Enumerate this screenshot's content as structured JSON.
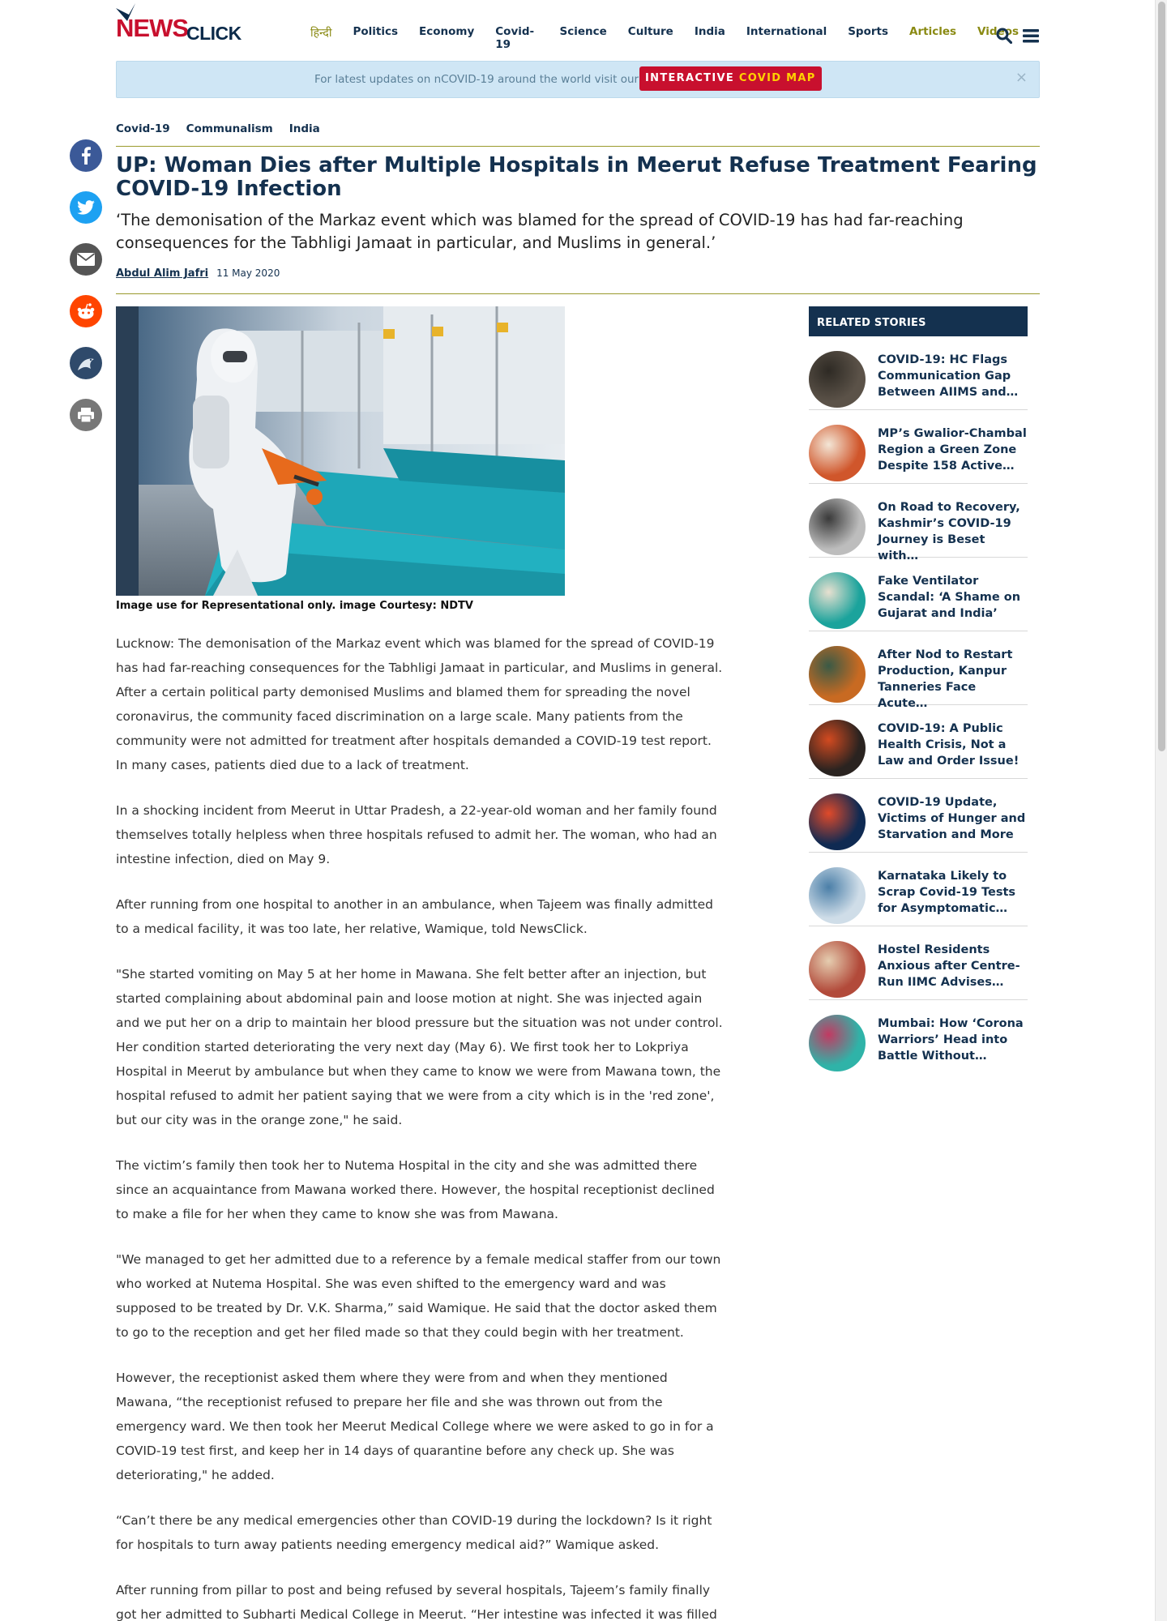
{
  "brand": {
    "logo_news": "NEWS",
    "logo_click": "CLICK"
  },
  "nav": {
    "items": [
      {
        "label": "हिन्दी",
        "style": "hindi"
      },
      {
        "label": "Politics"
      },
      {
        "label": "Economy"
      },
      {
        "label": "Covid-19"
      },
      {
        "label": "Science"
      },
      {
        "label": "Culture"
      },
      {
        "label": "India"
      },
      {
        "label": "International"
      },
      {
        "label": "Sports"
      },
      {
        "label": "Articles",
        "style": "olive"
      },
      {
        "label": "Videos",
        "style": "olive"
      }
    ],
    "search_icon": "search-icon",
    "menu_icon": "hamburger-menu-icon"
  },
  "banner": {
    "text": "For latest updates on nCOVID-19 around the world visit our",
    "cta_part1": "INTERACTIVE",
    "cta_part2": "COVID MAP",
    "close": "×"
  },
  "breadcrumb": [
    "Covid-19",
    "Communalism",
    "India"
  ],
  "article": {
    "title": "UP: Woman Dies after Multiple Hospitals in Meerut Refuse Treatment Fearing COVID-19 Infection",
    "subtitle": "‘The demonisation of the Markaz event which was blamed for the spread of COVID-19 has had far-reaching consequences for the Tabhligi Jamaat in particular, and Muslims in general.’",
    "author": "Abdul Alim Jafri",
    "date": "11 May 2020",
    "caption": "Image use for Representational only. image Courtesy: NDTV",
    "paragraphs": [
      "Lucknow: The demonisation of the Markaz event which was blamed for the spread of COVID-19 has had far-reaching consequences for the Tabhligi Jamaat in particular, and Muslims in general. After a certain political party demonised Muslims and blamed them for spreading the novel coronavirus, the community faced discrimination on a large scale. Many patients from the community were not admitted for treatment after hospitals demanded a COVID-19 test report. In many cases, patients died due to a lack of treatment.",
      "In a shocking incident from Meerut in Uttar Pradesh, a 22-year-old woman and her family found themselves totally helpless when three hospitals refused to admit her. The woman, who had an intestine infection, died on May 9.",
      "After running from one hospital to another in an ambulance, when Tajeem was finally admitted to a medical facility, it was too late, her relative, Wamique, told NewsClick.",
      "\"She started vomiting on May 5 at her home in Mawana. She felt better after an injection, but started complaining about abdominal pain and loose motion at night. She was injected again and we put her on a drip to maintain her blood pressure but the situation was not under control. Her condition started deteriorating the very next day (May 6). We first took her to Lokpriya Hospital in Meerut by ambulance but when they came to know we were from Mawana town, the hospital refused to admit her patient saying that we were from a city which is in the 'red zone', but our city was in the orange zone,\" he said.",
      "The victim’s family then took her to Nutema Hospital in the city and she was admitted there since an acquaintance from Mawana worked there. However, the hospital receptionist declined to make a file for her when they came to know she was from Mawana.",
      "\"We managed to get her admitted due to a reference by a female medical staffer from our town who worked at Nutema Hospital. She was even shifted to the emergency ward and was supposed to be treated by Dr. V.K. Sharma,” said Wamique. He said that the doctor asked them to go to the reception and get her filed made so that they could begin with her treatment.",
      "However, the receptionist asked them where they were from and when they mentioned Mawana, “the receptionist refused to prepare her file and she was thrown out from the emergency ward. We then took her Meerut Medical College where we were asked to go in for a COVID-19 test first, and keep her in 14 days of quarantine before any check up. She was deteriorating,\" he added.",
      "“Can’t there be any medical emergencies other than COVID-19 during the lockdown? Is it right for hospitals to turn away patients needing emergency medical aid?” Wamique asked.",
      "After running from pillar to post and being refused by several hospitals, Tajeem’s family finally got her admitted to Subharti Medical College in Meerut. “Her intestine was infected it was filled with water. She had a low hemoglobin count and even had a hole in her intestine. She was on ventilator"
    ]
  },
  "share": [
    {
      "icon": "facebook-icon",
      "color": "#3b5998"
    },
    {
      "icon": "twitter-icon",
      "color": "#1da1f2"
    },
    {
      "icon": "email-icon",
      "color": "#555555"
    },
    {
      "icon": "reddit-icon",
      "color": "#ff4500"
    },
    {
      "icon": "koo-icon",
      "color": "#2f4a6b"
    },
    {
      "icon": "print-icon",
      "color": "#777777"
    }
  ],
  "related": {
    "heading": "RELATED STORIES",
    "items": [
      {
        "title": "COVID-19: HC Flags Communication Gap Between AIIMS and…",
        "thumb": [
          "#5b5248",
          "#2e2a24"
        ]
      },
      {
        "title": "MP’s Gwalior-Chambal Region a Green Zone Despite 158 Active…",
        "thumb": [
          "#d0562b",
          "#f3e6d6"
        ]
      },
      {
        "title": "On Road to Recovery, Kashmir’s COVID-19 Journey is Beset with…",
        "thumb": [
          "#bdbdbd",
          "#3a3a3a"
        ]
      },
      {
        "title": "Fake Ventilator Scandal: ‘A Shame on Gujarat and India’",
        "thumb": [
          "#1ba39c",
          "#e8e0d0"
        ]
      },
      {
        "title": "After Nod to Restart Production, Kanpur Tanneries Face Acute…",
        "thumb": [
          "#c86a22",
          "#3a5a46"
        ]
      },
      {
        "title": "COVID-19: A Public Health Crisis, Not a Law and Order Issue!",
        "thumb": [
          "#2a2320",
          "#d24a20"
        ]
      },
      {
        "title": "COVID-19 Update, Victims of Hunger and Starvation and More",
        "thumb": [
          "#0f2a52",
          "#e04a2a"
        ]
      },
      {
        "title": "Karnataka Likely to Scrap Covid-19 Tests for Asymptomatic…",
        "thumb": [
          "#cfdde8",
          "#4b7fa8"
        ]
      },
      {
        "title": "Hostel Residents Anxious after Centre-Run IIMC Advises…",
        "thumb": [
          "#b24a3a",
          "#e5cdb0"
        ]
      },
      {
        "title": "Mumbai: How ‘Corona Warriors’ Head into Battle Without…",
        "thumb": [
          "#2fb3a8",
          "#c23a62"
        ]
      }
    ]
  }
}
